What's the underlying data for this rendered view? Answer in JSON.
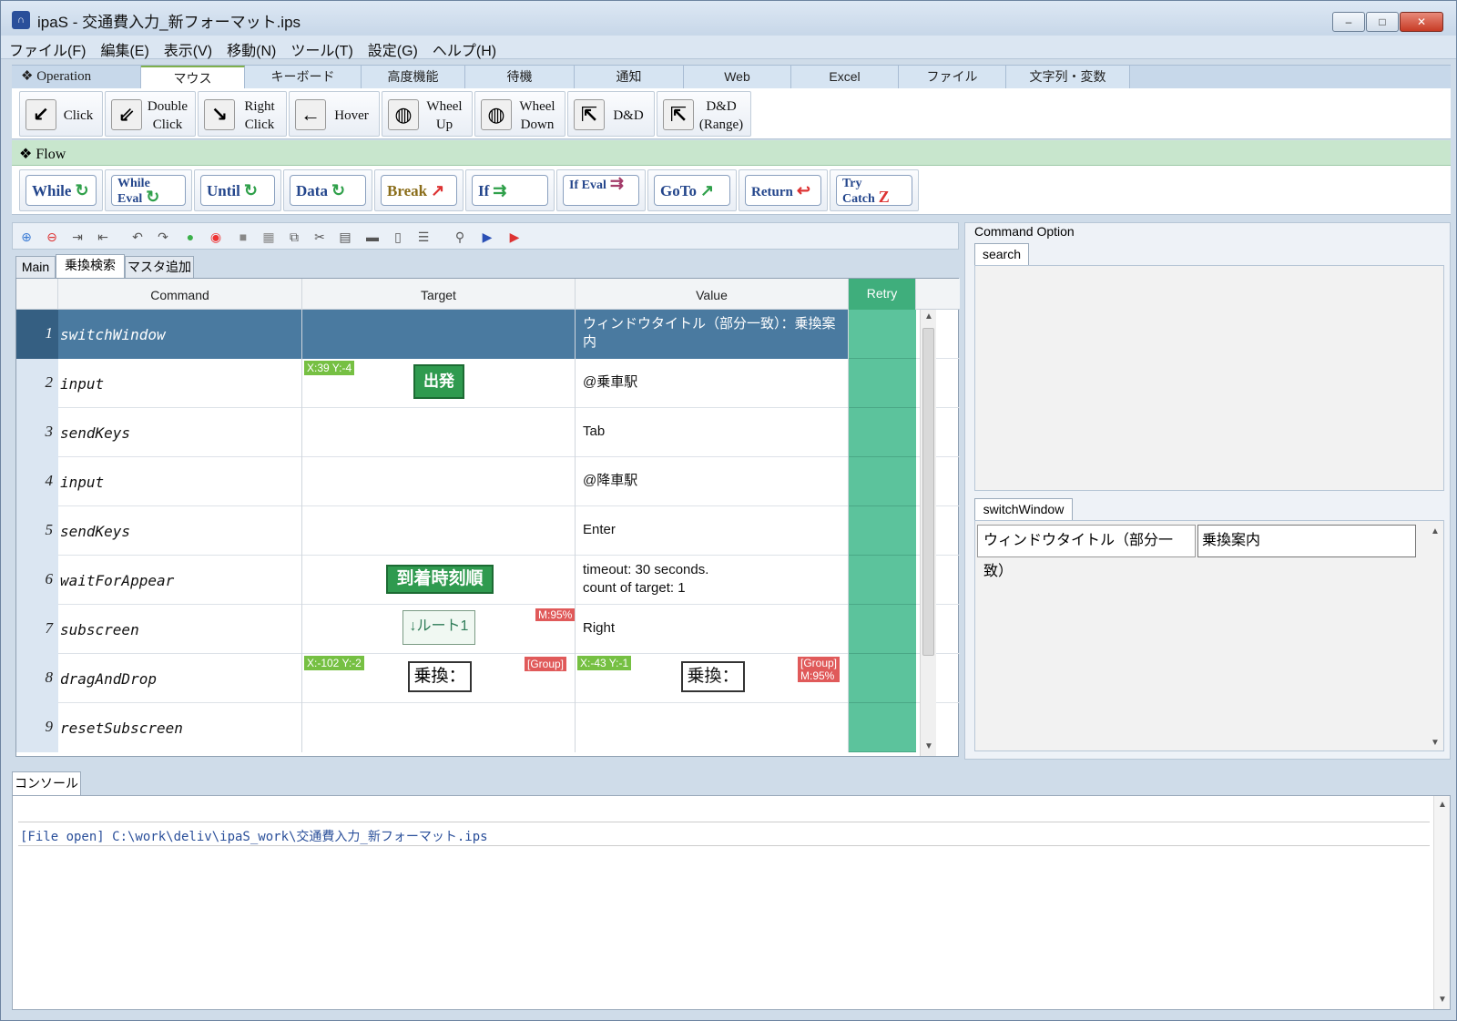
{
  "window": {
    "title": "ipaS - 交通費入力_新フォーマット.ips",
    "app_icon": "app-icon",
    "controls": {
      "minimize": "–",
      "maximize": "□",
      "close": "✕"
    }
  },
  "menu": [
    "ファイル(F)",
    "編集(E)",
    "表示(V)",
    "移動(N)",
    "ツール(T)",
    "設定(G)",
    "ヘルプ(H)"
  ],
  "ribbon": {
    "section_label": "❖ Operation",
    "tabs": [
      "マウス",
      "キーボード",
      "高度機能",
      "待機",
      "通知",
      "Web",
      "Excel",
      "ファイル",
      "文字列・変数"
    ],
    "active_tab": "マウス",
    "mouse_buttons": [
      {
        "label1": "Click",
        "label2": "",
        "icon": "↙"
      },
      {
        "label1": "Double",
        "label2": "Click",
        "icon": "⇙"
      },
      {
        "label1": "Right",
        "label2": "Click",
        "icon": "↘"
      },
      {
        "label1": "Hover",
        "label2": "",
        "icon": "←"
      },
      {
        "label1": "Wheel",
        "label2": "Up",
        "icon": "◍"
      },
      {
        "label1": "Wheel",
        "label2": "Down",
        "icon": "◍"
      },
      {
        "label1": "D&D",
        "label2": "",
        "icon": "⇱"
      },
      {
        "label1": "D&D",
        "label2": "(Range)",
        "icon": "⇱"
      }
    ]
  },
  "flow": {
    "section_label": "❖ Flow",
    "buttons": [
      {
        "label": "While",
        "sym": "↻"
      },
      {
        "label": "While Eval",
        "sym": "↻"
      },
      {
        "label": "Until",
        "sym": "↻"
      },
      {
        "label": "Data",
        "sym": "↻"
      },
      {
        "label": "Break",
        "sym": "↗"
      },
      {
        "label": "If",
        "sym": "⇉"
      },
      {
        "label": "If Eval",
        "sym": "⇉"
      },
      {
        "label": "GoTo",
        "sym": "↗"
      },
      {
        "label": "Return",
        "sym": "↩"
      },
      {
        "label": "Try Catch",
        "sym": "Z"
      }
    ]
  },
  "sheet_tabs": [
    "Main",
    "乗換検索",
    "マスタ追加"
  ],
  "active_sheet": "乗換検索",
  "grid": {
    "headers": {
      "command": "Command",
      "target": "Target",
      "value": "Value",
      "retry": "Retry"
    },
    "rows": [
      {
        "num": "1",
        "command": "switchWindow",
        "value": "ウィンドウタイトル（部分一致）：乗換案内"
      },
      {
        "num": "2",
        "command": "input",
        "target_pos": "X:39 Y:-4",
        "target_img": "出発",
        "value": "@乗車駅"
      },
      {
        "num": "3",
        "command": "sendKeys",
        "value": "Tab"
      },
      {
        "num": "4",
        "command": "input",
        "value": "@降車駅"
      },
      {
        "num": "5",
        "command": "sendKeys",
        "value": "Enter"
      },
      {
        "num": "6",
        "command": "waitForAppear",
        "target_img": "到着時刻順",
        "value_line1": "timeout: 30 seconds.",
        "value_line2": "count of target: 1"
      },
      {
        "num": "7",
        "command": "subscreen",
        "target_img": "↓ルート1",
        "target_match": "M:95%",
        "value": "Right"
      },
      {
        "num": "8",
        "command": "dragAndDrop",
        "target_pos": "X:-102 Y:-2",
        "target_img": "乗換：",
        "target_group": "[Group]",
        "value_pos": "X:-43 Y:-1",
        "value_img": "乗換：",
        "value_group": "[Group]",
        "value_match": "M:95%"
      },
      {
        "num": "9",
        "command": "resetSubscreen"
      }
    ]
  },
  "command_option": {
    "title": "Command Option",
    "search_tab": "search",
    "section_tab": "switchWindow",
    "property_label": "ウィンドウタイトル（部分一致）",
    "property_value": "乗換案内"
  },
  "console": {
    "tab": "コンソール",
    "line": "[File open] C:\\work\\deliv\\ipaS_work\\交通費入力_新フォーマット.ips"
  },
  "colors": {
    "selected_row": "#4a7aa0",
    "retry": "#5cc39c",
    "flow_header": "#c8e6cd"
  }
}
